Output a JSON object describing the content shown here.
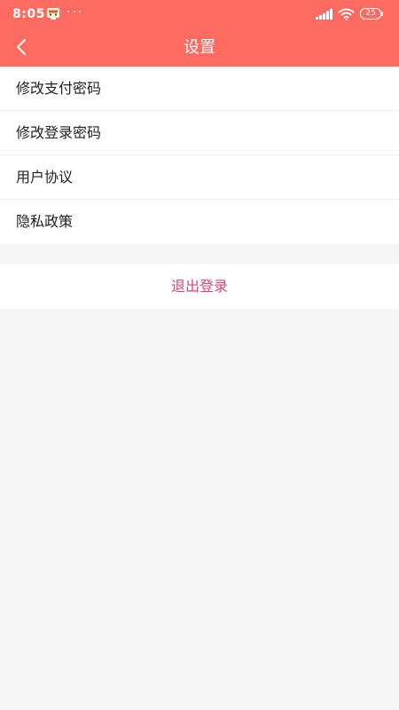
{
  "status_bar": {
    "time": "8:05",
    "dots": "···",
    "battery": "25"
  },
  "header": {
    "title": "设置"
  },
  "menu": {
    "items": [
      {
        "label": "修改支付密码"
      },
      {
        "label": "修改登录密码"
      },
      {
        "label": "用户协议"
      },
      {
        "label": "隐私政策"
      }
    ]
  },
  "logout": {
    "label": "退出登录"
  },
  "colors": {
    "header_bg": "#ff6b61",
    "logout_text": "#d9467a",
    "page_bg": "#f7f7f7"
  }
}
